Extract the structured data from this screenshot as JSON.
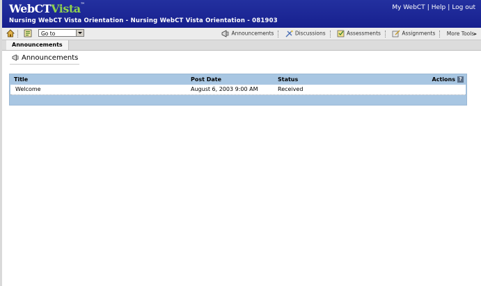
{
  "app": {
    "logo_main": "WebCT",
    "logo_accent": "Vista",
    "logo_tm": "™",
    "course_title": "Nursing WebCT Vista Orientation - Nursing WebCT Vista Orientation - 081903",
    "top_links": [
      "My WebCT",
      "Help",
      "Log out"
    ],
    "colors": {
      "header": "#1f2aa2",
      "logo_accent": "#8fd24e",
      "table_header": "#a8c6e2"
    }
  },
  "toolbar": {
    "goto_value": "Go to",
    "tools": [
      {
        "label": "Announcements",
        "icon": "announcements-icon"
      },
      {
        "label": "Discussions",
        "icon": "discussions-icon"
      },
      {
        "label": "Assessments",
        "icon": "assessments-icon"
      },
      {
        "label": "Assignments",
        "icon": "assignments-icon"
      },
      {
        "label": "More Tools▸",
        "icon": ""
      }
    ]
  },
  "tabs": {
    "active": "Announcements"
  },
  "page": {
    "title": "Announcements"
  },
  "table": {
    "headers": {
      "title": "Title",
      "post_date": "Post Date",
      "status": "Status",
      "actions": "Actions",
      "help": "?"
    },
    "rows": [
      {
        "title": "Welcome",
        "post_date": "August 6, 2003 9:00 AM",
        "status": "Received"
      }
    ]
  }
}
